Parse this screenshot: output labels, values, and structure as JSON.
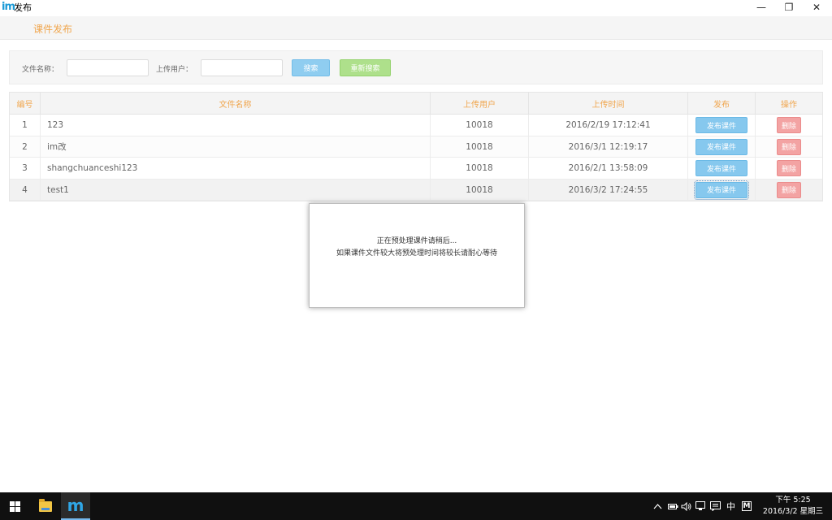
{
  "window": {
    "logo": "im",
    "title": "发布",
    "minimize": "—",
    "maximize": "❐",
    "close": "✕"
  },
  "page": {
    "header": "课件发布"
  },
  "search": {
    "name_label": "文件名称：",
    "name_value": "",
    "user_label": "上传用户：",
    "user_value": "",
    "search_button": "搜索",
    "reset_button": "重新搜索"
  },
  "table": {
    "headers": [
      "编号",
      "文件名称",
      "上传用户",
      "上传时间",
      "发布",
      "操作"
    ],
    "rows": [
      {
        "no": "1",
        "name": "123",
        "user": "10018",
        "time": "2016/2/19 17:12:41",
        "publish": "发布课件",
        "delete": "删除"
      },
      {
        "no": "2",
        "name": "im改",
        "user": "10018",
        "time": "2016/3/1 12:19:17",
        "publish": "发布课件",
        "delete": "删除"
      },
      {
        "no": "3",
        "name": "shangchuanceshi123",
        "user": "10018",
        "time": "2016/2/1 13:58:09",
        "publish": "发布课件",
        "delete": "删除"
      },
      {
        "no": "4",
        "name": "test1",
        "user": "10018",
        "time": "2016/3/2 17:24:55",
        "publish": "发布课件",
        "delete": "删除"
      }
    ]
  },
  "dialog": {
    "line1": "正在预处理课件请稍后...",
    "line2": "如果课件文件较大将预处理时间将较长请耐心等待"
  },
  "taskbar": {
    "tray_ime": "中",
    "tray_ime_icon": "M",
    "time": "下午 5:25",
    "date": "2016/3/2 星期三"
  },
  "colors": {
    "accent_orange": "#f0a64e",
    "publish_blue": "#86c8ee",
    "delete_red": "#f3a3a3",
    "reset_green": "#aee08b"
  }
}
